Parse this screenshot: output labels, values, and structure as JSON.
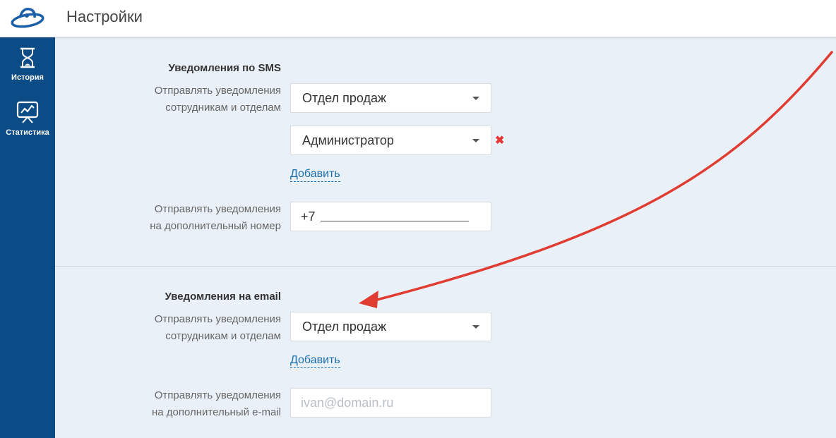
{
  "header": {
    "title": "Настройки",
    "logo_icon": "ufo-logo-icon"
  },
  "sidebar": {
    "items": [
      {
        "label": "История",
        "icon": "hourglass-icon"
      },
      {
        "label": "Статистика",
        "icon": "chart-board-icon"
      }
    ]
  },
  "sms": {
    "title": "Уведомления по SMS",
    "recipients_label_1": "Отправлять уведомления",
    "recipients_label_2": "сотрудникам и отделам",
    "select_1": "Отдел продаж",
    "select_2": "Администратор",
    "remove_symbol": "✖",
    "add_link": "Добавить",
    "extra_label_1": "Отправлять уведомления",
    "extra_label_2": "на дополнительный номер",
    "phone_prefix": "+7"
  },
  "email": {
    "title": "Уведомления на email",
    "recipients_label_1": "Отправлять уведомления",
    "recipients_label_2": "сотрудникам и отделам",
    "select_1": "Отдел продаж",
    "add_link": "Добавить",
    "extra_label_1": "Отправлять уведомления",
    "extra_label_2": "на дополнительный e-mail",
    "email_placeholder": "ivan@domain.ru"
  },
  "colors": {
    "sidebar": "#0b4b86",
    "link": "#1b6fae",
    "annotation_arrow": "#e03c31",
    "remove": "#e53935"
  }
}
